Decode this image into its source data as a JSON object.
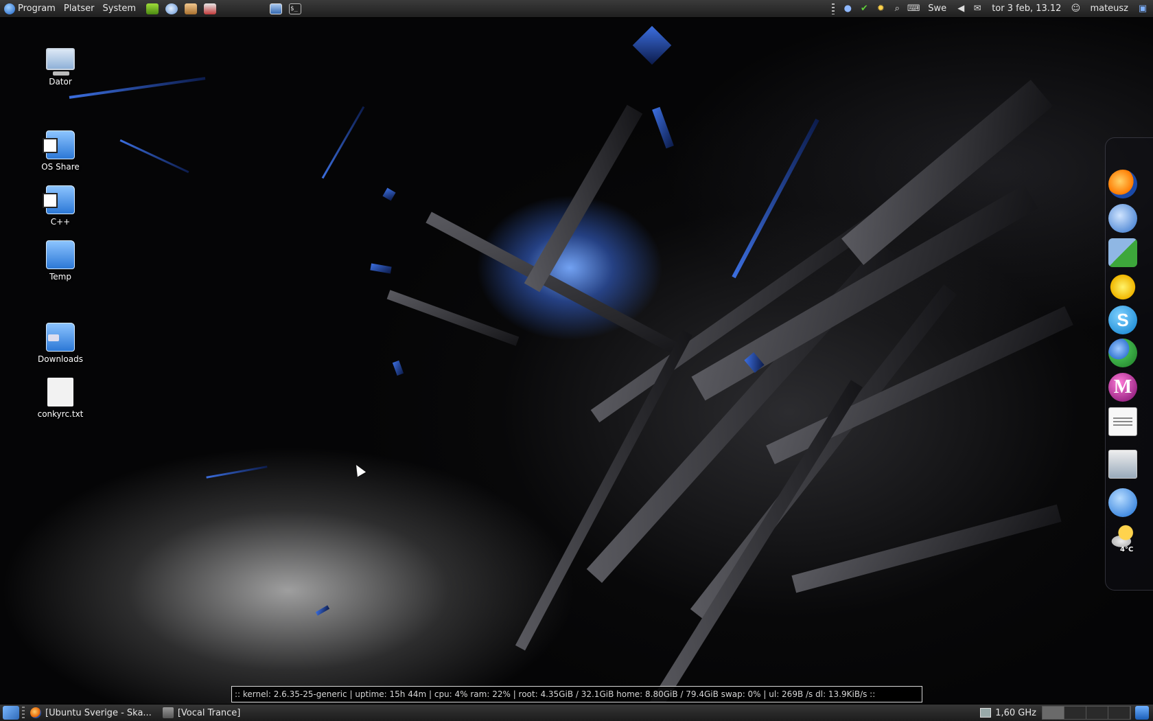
{
  "top_panel": {
    "menus": [
      {
        "label": "Program"
      },
      {
        "label": "Platser"
      },
      {
        "label": "System"
      }
    ],
    "launchers": [
      "nvidia-icon",
      "pidgin-icon",
      "package-icon",
      "gift-icon",
      "window-icon",
      "terminal-icon"
    ],
    "terminal_glyph": "$_",
    "keyboard_layout": "Swe",
    "datetime": "tor  3 feb, 13.12",
    "user": "mateusz"
  },
  "desktop_icons": [
    {
      "label": "Dator",
      "icon": "computer-icon"
    },
    {
      "label": "OS Share",
      "icon": "shared-folder-icon"
    },
    {
      "label": "C++",
      "icon": "shared-folder-icon"
    },
    {
      "label": "Temp",
      "icon": "folder-icon"
    },
    {
      "label": "Downloads",
      "icon": "downloads-folder-icon"
    },
    {
      "label": "conkyrc.txt",
      "icon": "text-file-icon"
    }
  ],
  "dock": {
    "items": [
      "firefox-icon",
      "thunderbird-icon",
      "media-player-icon",
      "pidgin-icon",
      "skype-icon",
      "empathy-icon",
      "m-app-icon",
      "writer-icon",
      "screenshot-icon",
      "gimp-icon",
      "weather-icon"
    ],
    "skype_glyph": "S",
    "m_glyph": "M",
    "weather_temp": "4°C"
  },
  "conky": {
    "text": ":: kernel: 2.6.35-25-generic  |  uptime: 15h 44m  |  cpu: 4%  ram: 22%  |  root: 4.35GiB / 32.1GiB  home: 8.80GiB / 79.4GiB  swap: 0%  |  ul: 269B  /s  dl: 13.9KiB/s ::"
  },
  "bottom_panel": {
    "tasks": [
      {
        "label": "[Ubuntu Sverige - Ska..."
      },
      {
        "label": "[Vocal Trance]"
      }
    ],
    "cpu_freq": "1,60 GHz",
    "workspaces_count": 4
  },
  "colors": {
    "panel": "#2b2b2b",
    "accent_blue": "#3c6fe0",
    "background": "#050506"
  }
}
